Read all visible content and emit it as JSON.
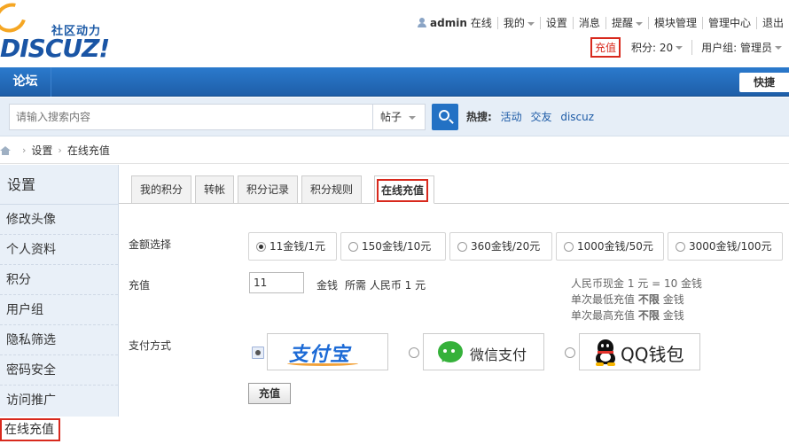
{
  "logo": {
    "slogan": "社区动力",
    "wordmark": "DISCUZ!"
  },
  "usernav": {
    "username": "admin",
    "online": "在线",
    "items": [
      "我的",
      "设置",
      "消息",
      "提醒",
      "模块管理",
      "管理中心",
      "退出"
    ]
  },
  "usernav2": {
    "recharge": "充值",
    "credits": "积分: 20",
    "group": "用户组: 管理员"
  },
  "navbar": {
    "forum": "论坛",
    "quick": "快捷"
  },
  "search": {
    "placeholder": "请输入搜索内容",
    "scope": "帖子",
    "hot_label": "热搜:",
    "hot_links": [
      "活动",
      "交友",
      "discuz"
    ]
  },
  "breadcrumb": {
    "items": [
      "设置",
      "在线充值"
    ]
  },
  "sidebar": {
    "title": "设置",
    "items": [
      "修改头像",
      "个人资料",
      "积分",
      "用户组",
      "隐私筛选",
      "密码安全",
      "访问推广"
    ],
    "active": "在线充值"
  },
  "tabs": {
    "items": [
      "我的积分",
      "转帐",
      "积分记录",
      "积分规则"
    ],
    "active": "在线充值"
  },
  "form": {
    "amount_label": "金额选择",
    "amount_options": [
      "11金钱/1元",
      "150金钱/10元",
      "360金钱/20元",
      "1000金钱/50元",
      "3000金钱/100元"
    ],
    "selected_amount_index": 0,
    "recharge_label": "充值",
    "recharge_value": "11",
    "unit": "金钱",
    "needs": "所需 人民币 1 元",
    "rate_line1": "人民币现金  1 元 =  10 金钱",
    "rate_line2_prefix": "单次最低充值",
    "rate_line2_value": "不限",
    "rate_line2_suffix": "金钱",
    "rate_line3_prefix": "单次最高充值",
    "rate_line3_value": "不限",
    "rate_line3_suffix": "金钱",
    "pay_label": "支付方式",
    "pay_methods": [
      "支付宝",
      "微信支付",
      "QQ钱包"
    ],
    "selected_pay_index": 0,
    "submit": "充值"
  }
}
